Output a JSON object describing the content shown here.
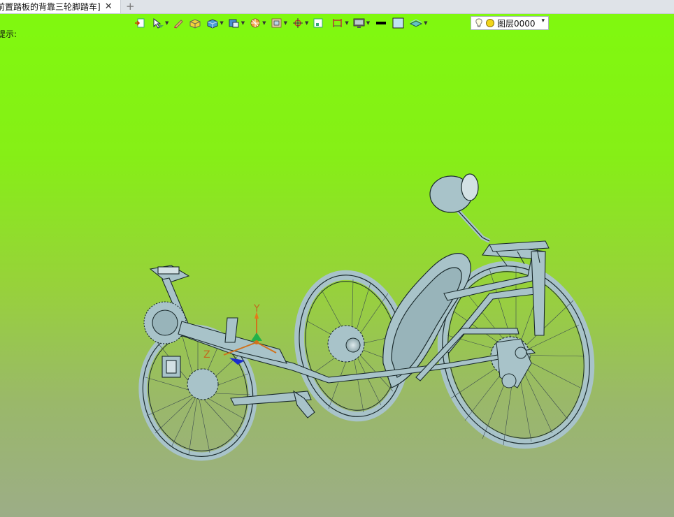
{
  "tab": {
    "title": "前置踏板的背靠三轮脚踏车]",
    "close": "✕",
    "new_tab": "+"
  },
  "hint": {
    "text": "提示:"
  },
  "toolbar": {
    "tools": [
      {
        "name": "exit-sketch-icon",
        "dropdown": false
      },
      {
        "name": "cursor-filter-icon",
        "dropdown": true
      },
      {
        "name": "pencil-icon",
        "dropdown": false
      },
      {
        "name": "shaded-box-icon",
        "dropdown": false
      },
      {
        "name": "view-cube-icon",
        "dropdown": true
      },
      {
        "name": "render-mode-icon",
        "dropdown": true
      },
      {
        "name": "section-view-icon",
        "dropdown": true
      },
      {
        "name": "zoom-fit-icon",
        "dropdown": true
      },
      {
        "name": "snap-point-icon",
        "dropdown": true
      },
      {
        "name": "select-box-icon",
        "dropdown": false
      },
      {
        "name": "measure-icon",
        "dropdown": true
      },
      {
        "name": "display-icon",
        "dropdown": true
      },
      {
        "name": "line-color-icon",
        "dropdown": false
      },
      {
        "name": "face-color-icon",
        "dropdown": false
      },
      {
        "name": "layer-style-icon",
        "dropdown": true
      }
    ],
    "layer": {
      "value": "图层0000",
      "arrow": "▾"
    }
  },
  "triad": {
    "x_label": "X",
    "y_label": "Y",
    "z_label": "Z"
  },
  "colors": {
    "bg_top": "#7ffa0e",
    "bg_bottom": "#9cad87",
    "model_fill": "#a8c3c9",
    "model_edge": "#1a2a2c"
  }
}
